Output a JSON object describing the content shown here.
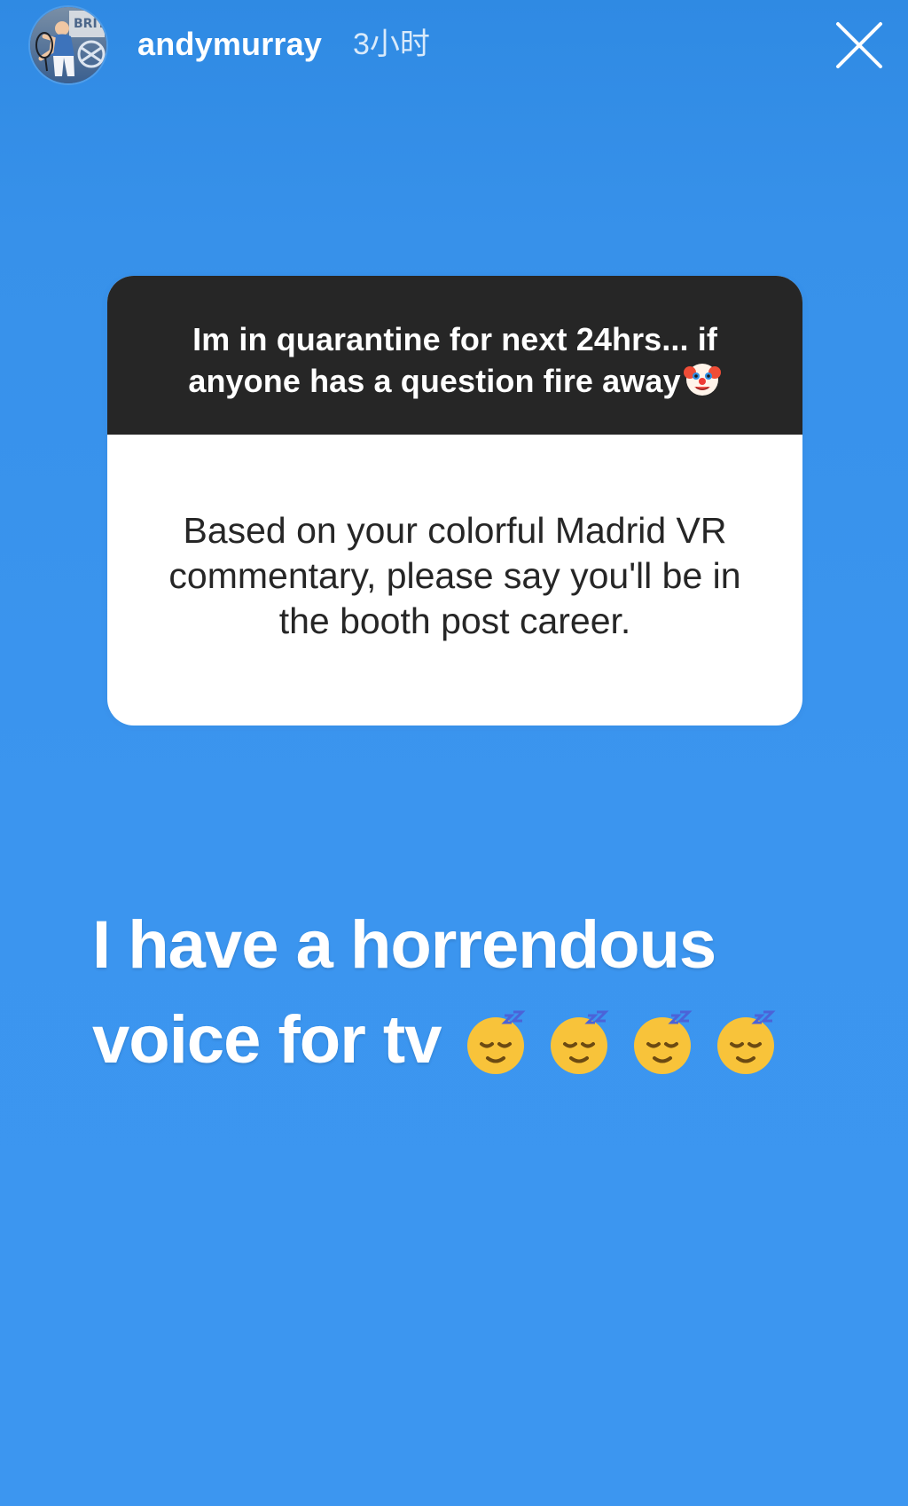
{
  "header": {
    "username": "andymurray",
    "time": "3小时",
    "avatar_text": "BRIT",
    "close_icon": "close-icon"
  },
  "question": {
    "prompt": "Im in quarantine for next 24hrs... if anyone has a question fire away",
    "prompt_emoji": "clown-face-icon",
    "answer": "Based on your colorful Madrid VR commentary, please say you'll be in the booth post career."
  },
  "caption": {
    "line1": "I have a horrendous",
    "line2": "voice for tv",
    "emoji": [
      "sleeping-face-icon",
      "sleeping-face-icon",
      "sleeping-face-icon",
      "sleeping-face-icon"
    ]
  },
  "colors": {
    "background": "#3b95ef",
    "prompt_background": "#262626",
    "card_background": "#ffffff",
    "text_dark": "#262626",
    "text_light": "#ffffff"
  }
}
